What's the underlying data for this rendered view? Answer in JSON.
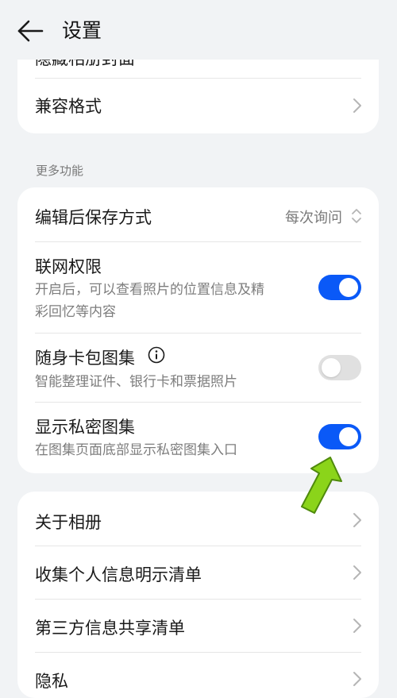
{
  "header": {
    "title": "设置"
  },
  "card_top": {
    "partial_label": "隐藏相册封面",
    "compat_label": "兼容格式"
  },
  "section": {
    "label": "更多功能"
  },
  "more": {
    "save_mode": {
      "title": "编辑后保存方式",
      "value": "每次询问"
    },
    "network": {
      "title": "联网权限",
      "desc_line1": "开启后，可以查看照片的位置信息及精",
      "desc_line2": "彩回忆等内容",
      "enabled": true
    },
    "wallet": {
      "title": "随身卡包图集",
      "desc": "智能整理证件、银行卡和票据照片",
      "enabled": false
    },
    "private": {
      "title": "显示私密图集",
      "desc": "在图集页面底部显示私密图集入口",
      "enabled": true
    }
  },
  "bottom": {
    "items": [
      {
        "label": "关于相册"
      },
      {
        "label": "收集个人信息明示清单"
      },
      {
        "label": "第三方信息共享清单"
      },
      {
        "label": "隐私"
      }
    ]
  },
  "colors": {
    "accent": "#0a59f7",
    "toggle_off": "#e0e0e0",
    "arrow": "#8bd41a"
  }
}
